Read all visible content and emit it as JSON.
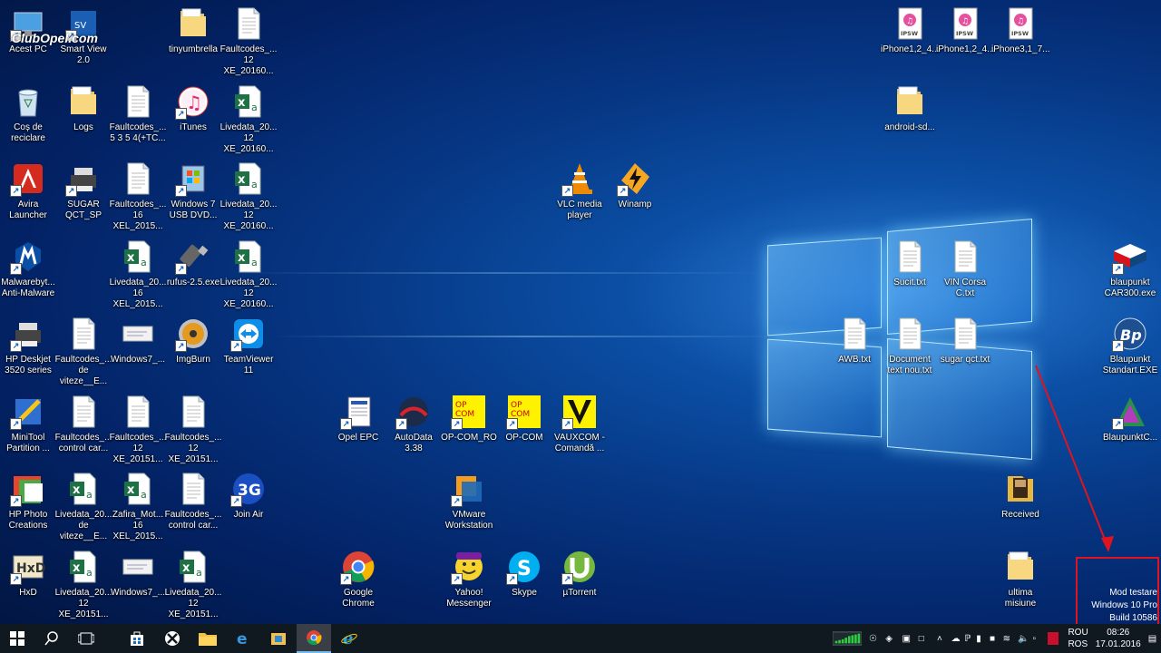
{
  "desktop": {
    "icons": [
      {
        "label": "Acest PC",
        "kind": "pc"
      },
      {
        "label": "Smart View\n2.0",
        "kind": "app"
      },
      {
        "label": "tinyumbrella",
        "kind": "folder"
      },
      {
        "label": "Faultcodes_...\n12 XE_20160...",
        "kind": "txt"
      },
      {
        "label": "Coș de\nreciclare",
        "kind": "recycle"
      },
      {
        "label": "Logs",
        "kind": "folder"
      },
      {
        "label": "Faultcodes_...\n5 3 5 4(+TC...",
        "kind": "txt"
      },
      {
        "label": "iTunes",
        "kind": "itunes"
      },
      {
        "label": "Livedata_20...\n12 XE_20160...",
        "kind": "excel"
      },
      {
        "label": "Avira\nLauncher",
        "kind": "avira"
      },
      {
        "label": "SUGAR\nQCT_SP",
        "kind": "printer"
      },
      {
        "label": "Faultcodes_...\n16 XEL_2015...",
        "kind": "txt"
      },
      {
        "label": "Windows 7\nUSB DVD...",
        "kind": "win7"
      },
      {
        "label": "Livedata_20...\n12 XE_20160...",
        "kind": "excel"
      },
      {
        "label": "Malwarebyt...\nAnti-Malware",
        "kind": "malware"
      },
      {
        "label": "Livedata_20...\n16 XEL_2015...",
        "kind": "excel"
      },
      {
        "label": "rufus-2.5.exe",
        "kind": "usb"
      },
      {
        "label": "Livedata_20...\n12 XE_20160...",
        "kind": "excel"
      },
      {
        "label": "HP Deskjet\n3520 series",
        "kind": "printer"
      },
      {
        "label": "Faultcodes_...\nde viteze__E...",
        "kind": "txt"
      },
      {
        "label": "Windows7_...",
        "kind": "img"
      },
      {
        "label": "ImgBurn",
        "kind": "disc"
      },
      {
        "label": "TeamViewer\n11",
        "kind": "teamviewer"
      },
      {
        "label": "MiniTool\nPartition ...",
        "kind": "minitool"
      },
      {
        "label": "Faultcodes_...\ncontrol car...",
        "kind": "txt"
      },
      {
        "label": "Faultcodes_...\n12 XE_20151...",
        "kind": "txt"
      },
      {
        "label": "Faultcodes_...\n12 XE_20151...",
        "kind": "txt"
      },
      {
        "label": "HP Photo\nCreations",
        "kind": "hpphoto"
      },
      {
        "label": "Livedata_20...\nde viteze__E...",
        "kind": "excel"
      },
      {
        "label": "Zafira_Mot...\n16 XEL_2015...",
        "kind": "excel"
      },
      {
        "label": "Faultcodes_...\ncontrol car...",
        "kind": "txt"
      },
      {
        "label": "Join Air",
        "kind": "joinair"
      },
      {
        "label": "HxD",
        "kind": "hxd"
      },
      {
        "label": "Livedata_20...\n12 XE_20151...",
        "kind": "excel"
      },
      {
        "label": "Windows7_...",
        "kind": "img"
      },
      {
        "label": "Livedata_20...\n12 XE_20151...",
        "kind": "excel"
      },
      {
        "label": "Opel EPC",
        "kind": "doc"
      },
      {
        "label": "AutoData\n3.38",
        "kind": "autodata"
      },
      {
        "label": "OP-COM_RO",
        "kind": "opcom"
      },
      {
        "label": "OP-COM",
        "kind": "opcom"
      },
      {
        "label": "VAUXCOM -\nComandă ...",
        "kind": "vauxcom"
      },
      {
        "label": "VMware\nWorkstation",
        "kind": "vmware"
      },
      {
        "label": "Google\nChrome",
        "kind": "chrome"
      },
      {
        "label": "Yahoo!\nMessenger",
        "kind": "yahoo"
      },
      {
        "label": "Skype",
        "kind": "skype"
      },
      {
        "label": "µTorrent",
        "kind": "utorrent"
      },
      {
        "label": "VLC media\nplayer",
        "kind": "vlc"
      },
      {
        "label": "Winamp",
        "kind": "winamp"
      },
      {
        "label": "iPhone1,2_4...",
        "kind": "ipsw"
      },
      {
        "label": "iPhone1,2_4...",
        "kind": "ipsw"
      },
      {
        "label": "iPhone3,1_7...",
        "kind": "ipsw"
      },
      {
        "label": "android-sd...",
        "kind": "folder"
      },
      {
        "label": "Sucit.txt",
        "kind": "txt"
      },
      {
        "label": "VIN Corsa\nC.txt",
        "kind": "txt"
      },
      {
        "label": "AWB.txt",
        "kind": "txt"
      },
      {
        "label": "Document\ntext nou.txt",
        "kind": "txt"
      },
      {
        "label": "sugar qct.txt",
        "kind": "txt"
      },
      {
        "label": "blaupunkt\nCAR300.exe",
        "kind": "flag"
      },
      {
        "label": "Blaupunkt\nStandart.EXE",
        "kind": "bp"
      },
      {
        "label": "BlaupunktC...",
        "kind": "bpc"
      },
      {
        "label": "Received",
        "kind": "folder-dark"
      },
      {
        "label": "ultima\nmisiune",
        "kind": "folder"
      }
    ]
  },
  "watermark_logo": "ClubOpel.com",
  "ipsw_badge": "IPSW",
  "activation": {
    "line1": "Mod testare",
    "line2": "Windows 10 Pro",
    "line3": "Build 10586"
  },
  "taskbar": {
    "lang_top": "ROU",
    "lang_bottom": "ROS",
    "time": "08:26",
    "date": "17.01.2016"
  }
}
